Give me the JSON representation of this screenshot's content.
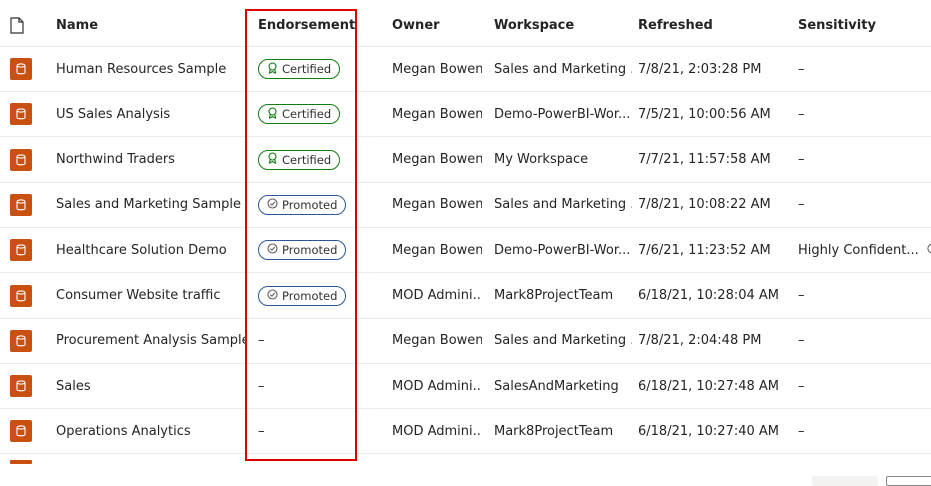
{
  "columns": {
    "name": "Name",
    "endorsement": "Endorsement",
    "owner": "Owner",
    "workspace": "Workspace",
    "refreshed": "Refreshed",
    "sensitivity": "Sensitivity"
  },
  "icons": {
    "header": "file-icon",
    "row": "dataset-icon",
    "certified": "certified-icon",
    "promoted": "promoted-icon",
    "info": "info-icon"
  },
  "colors": {
    "dataset": "#ca5010",
    "certified_border": "#107c10",
    "promoted_border": "#2b579a",
    "highlight": "#e00000"
  },
  "rows": [
    {
      "name": "Human Resources Sample",
      "endorsement": "Certified",
      "owner": "Megan Bowen",
      "workspace": "Sales and Marketing ...",
      "refreshed": "7/8/21, 2:03:28 PM",
      "sensitivity": "–"
    },
    {
      "name": "US Sales Analysis",
      "endorsement": "Certified",
      "owner": "Megan Bowen",
      "workspace": "Demo-PowerBI-Wor...",
      "refreshed": "7/5/21, 10:00:56 AM",
      "sensitivity": "–"
    },
    {
      "name": "Northwind Traders",
      "endorsement": "Certified",
      "owner": "Megan Bowen",
      "workspace": "My Workspace",
      "refreshed": "7/7/21, 11:57:58 AM",
      "sensitivity": "–"
    },
    {
      "name": "Sales and Marketing Sample P...",
      "endorsement": "Promoted",
      "owner": "Megan Bowen",
      "workspace": "Sales and Marketing ...",
      "refreshed": "7/8/21, 10:08:22 AM",
      "sensitivity": "–"
    },
    {
      "name": "Healthcare Solution Demo",
      "endorsement": "Promoted",
      "owner": "Megan Bowen",
      "workspace": "Demo-PowerBI-Wor...",
      "refreshed": "7/6/21, 11:23:52 AM",
      "sensitivity": "Highly Confident..."
    },
    {
      "name": "Consumer Website traffic",
      "endorsement": "Promoted",
      "owner": "MOD Admini...",
      "workspace": "Mark8ProjectTeam",
      "refreshed": "6/18/21, 10:28:04 AM",
      "sensitivity": "–"
    },
    {
      "name": "Procurement Analysis Sample",
      "endorsement": "–",
      "owner": "Megan Bowen",
      "workspace": "Sales and Marketing ...",
      "refreshed": "7/8/21, 2:04:48 PM",
      "sensitivity": "–"
    },
    {
      "name": "Sales",
      "endorsement": "–",
      "owner": "MOD Admini...",
      "workspace": "SalesAndMarketing",
      "refreshed": "6/18/21, 10:27:48 AM",
      "sensitivity": "–"
    },
    {
      "name": "Operations Analytics",
      "endorsement": "–",
      "owner": "MOD Admini...",
      "workspace": "Mark8ProjectTeam",
      "refreshed": "6/18/21, 10:27:40 AM",
      "sensitivity": "–"
    }
  ]
}
